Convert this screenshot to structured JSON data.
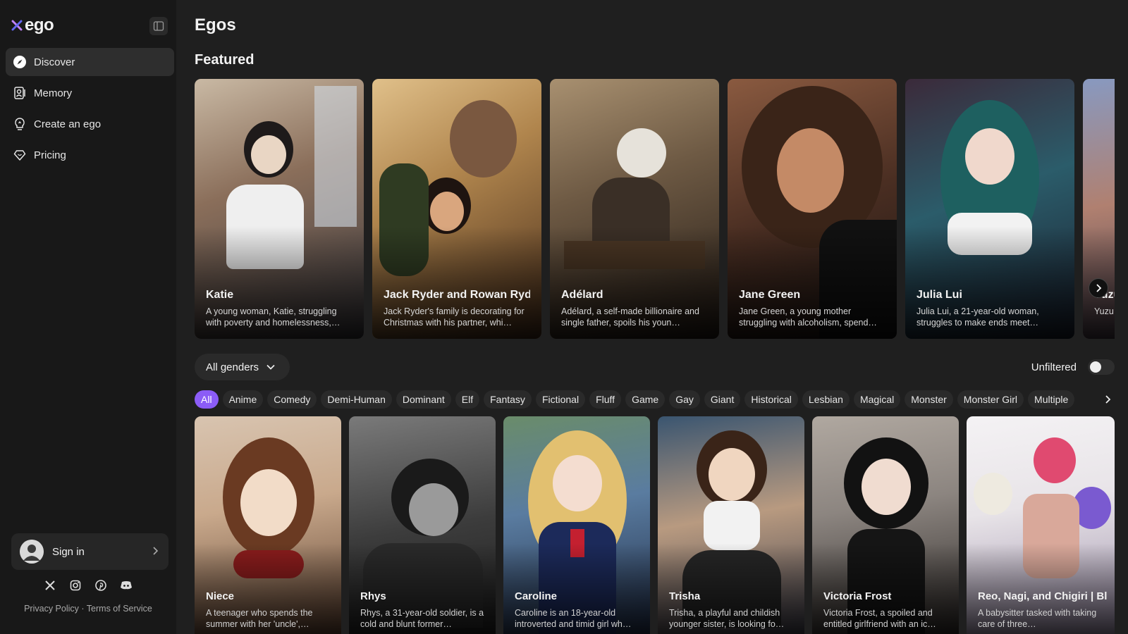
{
  "app": {
    "logo_text": "ego"
  },
  "sidebar": {
    "items": [
      {
        "label": "Discover",
        "icon": "compass-icon",
        "active": true
      },
      {
        "label": "Memory",
        "icon": "memory-icon",
        "active": false
      },
      {
        "label": "Create an ego",
        "icon": "lightbulb-icon",
        "active": false
      },
      {
        "label": "Pricing",
        "icon": "diamond-heart-icon",
        "active": false
      }
    ],
    "signin_label": "Sign in",
    "socials": [
      "x-icon",
      "instagram-icon",
      "pinterest-icon",
      "discord-icon"
    ],
    "legal": {
      "privacy": "Privacy Policy",
      "separator": "·",
      "terms": "Terms of Service"
    }
  },
  "main": {
    "title": "Egos",
    "featured_title": "Featured",
    "featured": [
      {
        "name": "Katie",
        "desc": "A young woman, Katie, struggling with poverty and homelessness,…",
        "colors": [
          "#8a7a6a",
          "#3b3a3f"
        ]
      },
      {
        "name": "Jack Ryder and Rowan Ryder",
        "desc": "Jack Ryder's family is decorating for Christmas with his partner, whi…",
        "colors": [
          "#b0854d",
          "#4a2f1c"
        ]
      },
      {
        "name": "Adélard",
        "desc": "Adélard, a self-made billionaire and single father, spoils his youn…",
        "colors": [
          "#6e5a44",
          "#251c16"
        ]
      },
      {
        "name": "Jane Green",
        "desc": "Jane Green, a young mother struggling with alcoholism, spend…",
        "colors": [
          "#6b4432",
          "#1c1512"
        ]
      },
      {
        "name": "Julia Lui",
        "desc": "Julia Lui, a 21-year-old woman, struggles to make ends meet…",
        "colors": [
          "#2b5c6a",
          "#1b2130"
        ]
      },
      {
        "name": "Yuzu",
        "desc": "Yuzu…high",
        "colors": [
          "#8899c0",
          "#403a4a"
        ]
      }
    ],
    "gender_filter": "All genders",
    "unfiltered_label": "Unfiltered",
    "tags": [
      "All",
      "Anime",
      "Comedy",
      "Demi-Human",
      "Dominant",
      "Elf",
      "Fantasy",
      "Fictional",
      "Fluff",
      "Game",
      "Gay",
      "Giant",
      "Historical",
      "Lesbian",
      "Magical",
      "Monster",
      "Monster Girl",
      "Multiple"
    ],
    "active_tag": "All",
    "cards": [
      {
        "name": "Niece",
        "desc": "A teenager who spends the summer with her 'uncle',…",
        "colors": [
          "#c9a98c",
          "#5a3d2c"
        ]
      },
      {
        "name": "Rhys",
        "desc": "Rhys, a 31-year-old soldier, is a cold and blunt former…",
        "colors": [
          "#7a7a7a",
          "#1c1c1c"
        ]
      },
      {
        "name": "Caroline",
        "desc": "Caroline is an 18-year-old introverted and timid girl wh…",
        "colors": [
          "#5a7ca0",
          "#1e2a44"
        ]
      },
      {
        "name": "Trisha",
        "desc": "Trisha, a playful and childish younger sister, is looking fo…",
        "colors": [
          "#b89a80",
          "#3a3c4a"
        ]
      },
      {
        "name": "Victoria Frost",
        "desc": "Victoria Frost, a spoiled and entitled girlfriend with an ic…",
        "colors": [
          "#8c8580",
          "#2a2624"
        ]
      },
      {
        "name": "Reo, Nagi, and Chigiri | Blue Lock",
        "desc": "A babysitter tasked with taking care of three…",
        "colors": [
          "#e8e4e8",
          "#9a8ca8"
        ]
      }
    ]
  }
}
